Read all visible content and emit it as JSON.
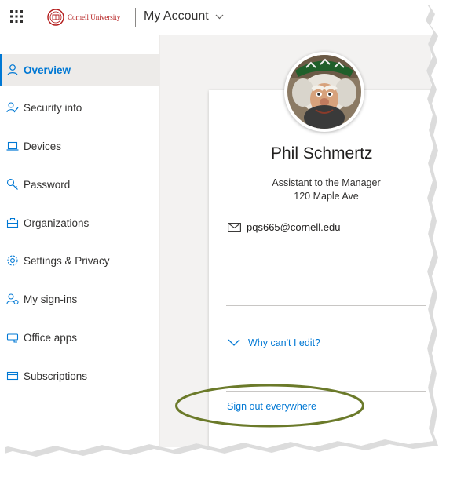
{
  "header": {
    "org_logo_text": "Cornell University",
    "app_title": "My Account"
  },
  "sidebar": {
    "items": [
      {
        "label": "Overview",
        "icon": "person-icon",
        "active": true
      },
      {
        "label": "Security info",
        "icon": "security-info-icon",
        "active": false
      },
      {
        "label": "Devices",
        "icon": "laptop-icon",
        "active": false
      },
      {
        "label": "Password",
        "icon": "key-icon",
        "active": false
      },
      {
        "label": "Organizations",
        "icon": "briefcase-icon",
        "active": false
      },
      {
        "label": "Settings & Privacy",
        "icon": "gear-icon",
        "active": false
      },
      {
        "label": "My sign-ins",
        "icon": "sign-ins-icon",
        "active": false
      },
      {
        "label": "Office apps",
        "icon": "office-apps-icon",
        "active": false
      },
      {
        "label": "Subscriptions",
        "icon": "subscriptions-icon",
        "active": false
      }
    ]
  },
  "profile": {
    "name": "Phil Schmertz",
    "job_title": "Assistant to the Manager",
    "address": "120 Maple Ave",
    "email": "pqs665@cornell.edu",
    "why_cant_edit": "Why can't I edit?",
    "sign_out_everywhere": "Sign out everywhere"
  },
  "colors": {
    "accent": "#0078d4",
    "annotation_ellipse": "#6b7a2a",
    "brand_red": "#b31b1b"
  }
}
